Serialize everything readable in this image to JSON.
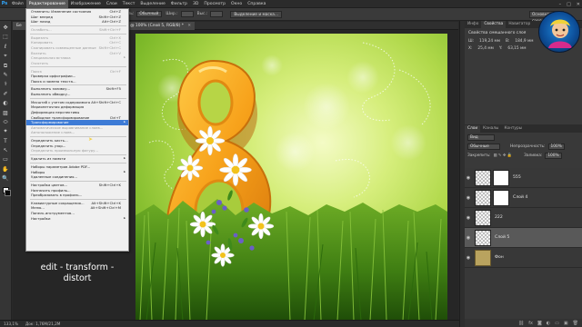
{
  "app": {
    "logo": "Ps",
    "menu": [
      "Файл",
      "Редактирование",
      "Изображение",
      "Слои",
      "Текст",
      "Выделение",
      "Фильтр",
      "3D",
      "Просмотр",
      "Окно",
      "Справка"
    ],
    "active_menu_index": 1,
    "window_controls": [
      "–",
      "□",
      "✕"
    ]
  },
  "options_bar": {
    "style_label": "Стиль:",
    "style_value": "Обычный",
    "width_label": "Шир.:",
    "height_label": "Выс.:",
    "refine_button": "Выделение и маска...",
    "workspace": "Основная среда"
  },
  "document": {
    "tab_title": "Бе",
    "tab_info": "@ 100% (Слой 5, RGB/8) *",
    "zoom": "133,1%",
    "doc_size": "Док: 1,76М/21,2М"
  },
  "caption": {
    "line1": "edit - transform -",
    "line2": "distort"
  },
  "properties_panel": {
    "tabs": [
      "Инфо",
      "Свойства",
      "Навигатор"
    ],
    "title": "Свойства смешанного слоя",
    "w_label": "Ш:",
    "w_value": "119,24 мм",
    "h_label": "В:",
    "h_value": "184,9 мм",
    "x_label": "X:",
    "x_value": "25,4 мм",
    "y_label": "Y:",
    "y_value": "63,15 мм"
  },
  "layers_panel": {
    "tabs": [
      "Слои",
      "Каналы",
      "Контуры"
    ],
    "filter": "Вид",
    "blend_mode": "Обычные",
    "opacity_label": "Непрозрачность:",
    "opacity_value": "100%",
    "lock_label": "Закрепить:",
    "fill_label": "Заливка:",
    "fill_value": "100%",
    "layers": [
      {
        "name": "555",
        "type": "layer",
        "visible": true,
        "selected": false
      },
      {
        "name": "Слой 4",
        "type": "layer",
        "visible": true,
        "selected": false
      },
      {
        "name": "222",
        "type": "layer",
        "visible": true,
        "selected": false
      },
      {
        "name": "Слой 5",
        "type": "layer",
        "visible": true,
        "selected": true
      },
      {
        "name": "Фон",
        "type": "group",
        "visible": true,
        "selected": false
      }
    ]
  },
  "edit_menu": [
    {
      "label": "Отменить: Изменение состояния",
      "shortcut": "Ctrl+Z",
      "disabled": false
    },
    {
      "label": "Шаг вперед",
      "shortcut": "Shift+Ctrl+Z",
      "disabled": false
    },
    {
      "label": "Шаг назад",
      "shortcut": "Alt+Ctrl+Z",
      "disabled": false
    },
    {
      "sep": true
    },
    {
      "label": "Ослабить...",
      "shortcut": "Shift+Ctrl+F",
      "disabled": true
    },
    {
      "sep": true
    },
    {
      "label": "Вырезать",
      "shortcut": "Ctrl+X",
      "disabled": true
    },
    {
      "label": "Копировать",
      "shortcut": "Ctrl+C",
      "disabled": true
    },
    {
      "label": "Скопировать совмещенные данные",
      "shortcut": "Shift+Ctrl+C",
      "disabled": true
    },
    {
      "label": "Вклеить",
      "shortcut": "Ctrl+V",
      "disabled": true
    },
    {
      "label": "Специальная вставка",
      "arrow": true,
      "disabled": true
    },
    {
      "label": "Очистить",
      "disabled": true
    },
    {
      "sep": true
    },
    {
      "label": "Поиск",
      "shortcut": "Ctrl+F",
      "disabled": true
    },
    {
      "label": "Проверка орфографии...",
      "disabled": false
    },
    {
      "label": "Поиск и замена текста...",
      "disabled": false
    },
    {
      "sep": true
    },
    {
      "label": "Выполнить заливку...",
      "shortcut": "Shift+F5",
      "disabled": false
    },
    {
      "label": "Выполнить обводку...",
      "disabled": false
    },
    {
      "sep": true
    },
    {
      "label": "Масштаб с учетом содержимого",
      "shortcut": "Alt+Shift+Ctrl+C",
      "disabled": false
    },
    {
      "label": "Марионеточная деформация",
      "disabled": false
    },
    {
      "label": "Деформация перспективы",
      "disabled": false
    },
    {
      "label": "Свободное трансформирование",
      "shortcut": "Ctrl+T",
      "disabled": false
    },
    {
      "label": "Трансформирование",
      "arrow": true,
      "hover": true,
      "disabled": false
    },
    {
      "label": "Автоматическое выравнивание слоев...",
      "disabled": true
    },
    {
      "label": "Автоналожение слоев...",
      "disabled": true
    },
    {
      "sep": true
    },
    {
      "label": "Определить кисть...",
      "disabled": false
    },
    {
      "label": "Определить узор...",
      "disabled": false
    },
    {
      "label": "Определить произвольную фигуру...",
      "disabled": true
    },
    {
      "sep": true
    },
    {
      "label": "Удалить из памяти",
      "arrow": true,
      "disabled": false
    },
    {
      "sep": true
    },
    {
      "label": "Наборы параметров Adobe PDF...",
      "disabled": false
    },
    {
      "label": "Наборы",
      "arrow": true,
      "disabled": false
    },
    {
      "label": "Удаленные соединения...",
      "disabled": false
    },
    {
      "sep": true
    },
    {
      "label": "Настройка цветов...",
      "shortcut": "Shift+Ctrl+K",
      "disabled": false
    },
    {
      "label": "Назначить профиль...",
      "disabled": false
    },
    {
      "label": "Преобразовать в профиль...",
      "disabled": false
    },
    {
      "sep": true
    },
    {
      "label": "Клавиатурные сокращения...",
      "shortcut": "Alt+Shift+Ctrl+K",
      "disabled": false
    },
    {
      "label": "Меню...",
      "shortcut": "Alt+Shift+Ctrl+M",
      "disabled": false
    },
    {
      "label": "Панель инструментов...",
      "disabled": false
    },
    {
      "label": "Настройки",
      "arrow": true,
      "disabled": false
    }
  ],
  "tools": [
    "✥",
    "⬚",
    "ℓ",
    "⌖",
    "⧉",
    "✎",
    "⚕",
    "✐",
    "◐",
    "▨",
    "⬭",
    "✦",
    "T",
    "↖",
    "▭",
    "✋",
    "🔍"
  ]
}
